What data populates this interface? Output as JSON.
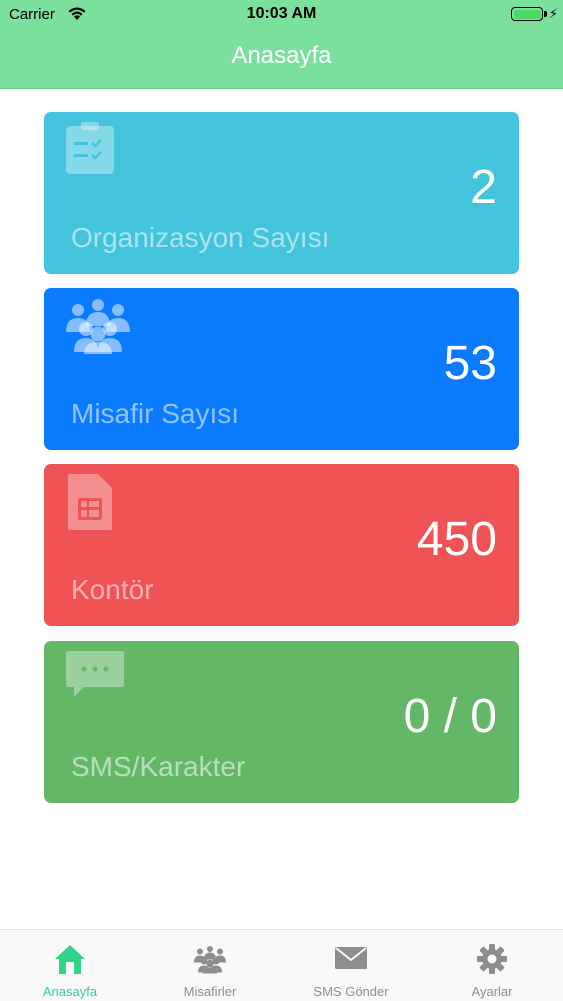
{
  "status_bar": {
    "carrier": "Carrier",
    "time": "10:03 AM"
  },
  "nav": {
    "title": "Anasayfa"
  },
  "cards": [
    {
      "value": "2",
      "label": "Organizasyon Sayısı",
      "icon": "clipboard-checklist-icon",
      "color": "#43c4dc"
    },
    {
      "value": "53",
      "label": "Misafir Sayısı",
      "icon": "people-group-icon",
      "color": "#0a7afe"
    },
    {
      "value": "450",
      "label": "Kontör",
      "icon": "sim-card-icon",
      "color": "#ef5355"
    },
    {
      "value": "0 / 0",
      "label": "SMS/Karakter",
      "icon": "chat-bubble-icon",
      "color": "#64b766"
    }
  ],
  "tabs": [
    {
      "label": "Anasayfa",
      "icon": "home-icon",
      "active": true
    },
    {
      "label": "Misafirler",
      "icon": "people-group-icon",
      "active": false
    },
    {
      "label": "SMS Gönder",
      "icon": "envelope-icon",
      "active": false
    },
    {
      "label": "Ayarlar",
      "icon": "gear-icon",
      "active": false
    }
  ],
  "colors": {
    "nav_background": "#7bdf9d",
    "tab_active": "#2fd38a",
    "tab_inactive": "#8e8e8e"
  }
}
